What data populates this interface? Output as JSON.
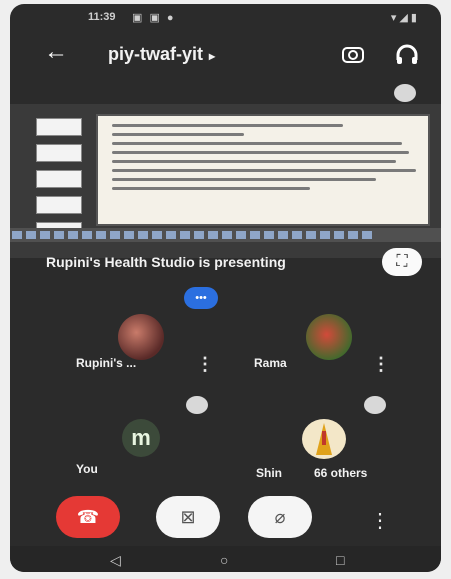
{
  "status": {
    "time": "11:39",
    "icons": "▣ ▣ ●",
    "right": "▾ ◢ ▮"
  },
  "header": {
    "meeting_code": "piy-twaf-yit",
    "caret": "▸",
    "back": "←",
    "rotate": "⟳",
    "audio": "🎧"
  },
  "presentation": {
    "presenting_text": "Rupini's Health Studio is presenting",
    "fullscreen": "⛶"
  },
  "participants": [
    {
      "name": "Rupini's ...",
      "more": "⋮"
    },
    {
      "name": "Rama",
      "more": "⋮"
    },
    {
      "name": "You",
      "initial": "m"
    },
    {
      "name": "Shin"
    }
  ],
  "others_label": "66 others",
  "controls": {
    "end": "☎",
    "camera": "⊠",
    "mic": "⌀",
    "more": "⋮"
  },
  "nav": {
    "back": "◁",
    "home": "○",
    "recent": "□"
  }
}
